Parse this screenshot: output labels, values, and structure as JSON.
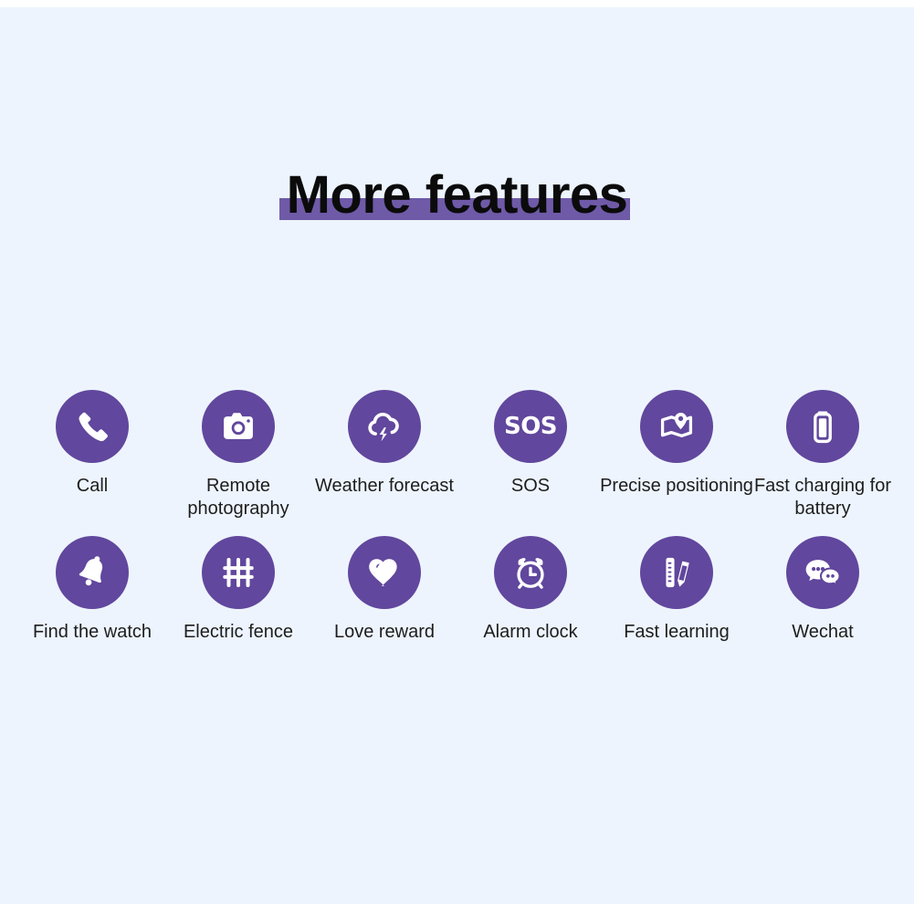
{
  "page": {
    "background_color": "#edf4fd",
    "accent_color": "#61479d",
    "highlight_color": "#6f5aa8",
    "label_color": "#1d1d1d"
  },
  "header": {
    "title": "More features"
  },
  "features": {
    "rows": [
      {
        "items": [
          {
            "icon": "phone-icon",
            "label": "Call"
          },
          {
            "icon": "camera-icon",
            "label": "Remote photography"
          },
          {
            "icon": "cloud-lightning-icon",
            "label": "Weather forecast"
          },
          {
            "icon": "sos-icon",
            "label": "SOS",
            "icon_text": "SOS"
          },
          {
            "icon": "map-pin-icon",
            "label": "Precise positioning"
          },
          {
            "icon": "battery-icon",
            "label": "Fast charging for battery"
          }
        ]
      },
      {
        "items": [
          {
            "icon": "bell-icon",
            "label": "Find the watch"
          },
          {
            "icon": "fence-icon",
            "label": "Electric fence"
          },
          {
            "icon": "heart-icon",
            "label": "Love reward"
          },
          {
            "icon": "alarm-clock-icon",
            "label": "Alarm clock"
          },
          {
            "icon": "ruler-pencil-icon",
            "label": "Fast learning"
          },
          {
            "icon": "chat-bubbles-icon",
            "label": "Wechat"
          }
        ]
      }
    ]
  }
}
